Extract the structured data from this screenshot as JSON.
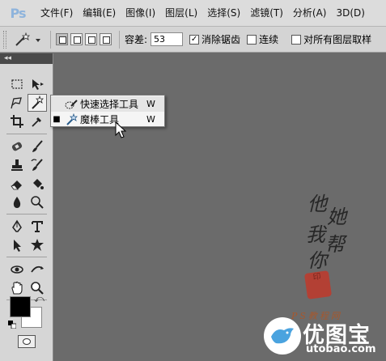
{
  "app": {
    "logo": "Ps"
  },
  "menu": {
    "items": [
      {
        "label": "文件(F)"
      },
      {
        "label": "编辑(E)"
      },
      {
        "label": "图像(I)"
      },
      {
        "label": "图层(L)"
      },
      {
        "label": "选择(S)"
      },
      {
        "label": "滤镜(T)"
      },
      {
        "label": "分析(A)"
      },
      {
        "label": "3D(D)"
      }
    ]
  },
  "options": {
    "tolerance_label": "容差:",
    "tolerance_value": "53",
    "antialias_label": "消除锯齿",
    "antialias_checked": "✓",
    "contiguous_label": "连续",
    "all_layers_label": "对所有图层取样"
  },
  "tools_panel": {
    "collapse_glyph": "◂◂"
  },
  "flyout": {
    "items": [
      {
        "label": "快速选择工具",
        "shortcut": "W",
        "active": false,
        "icon": "quick-selection-icon"
      },
      {
        "label": "魔棒工具",
        "shortcut": "W",
        "active": true,
        "bullet": "■",
        "icon": "magic-wand-icon"
      }
    ]
  },
  "colors": {
    "foreground": "#000000",
    "background": "#ffffff",
    "canvas": "#6b6b6b",
    "menubar": "#dcdcdc"
  },
  "watermark": {
    "calligraphy": [
      "他",
      "她",
      "我",
      "帮",
      "你"
    ],
    "seal_text": "印",
    "small_text": "PS教程网",
    "brand": "优图宝",
    "url": "utobao.com"
  }
}
